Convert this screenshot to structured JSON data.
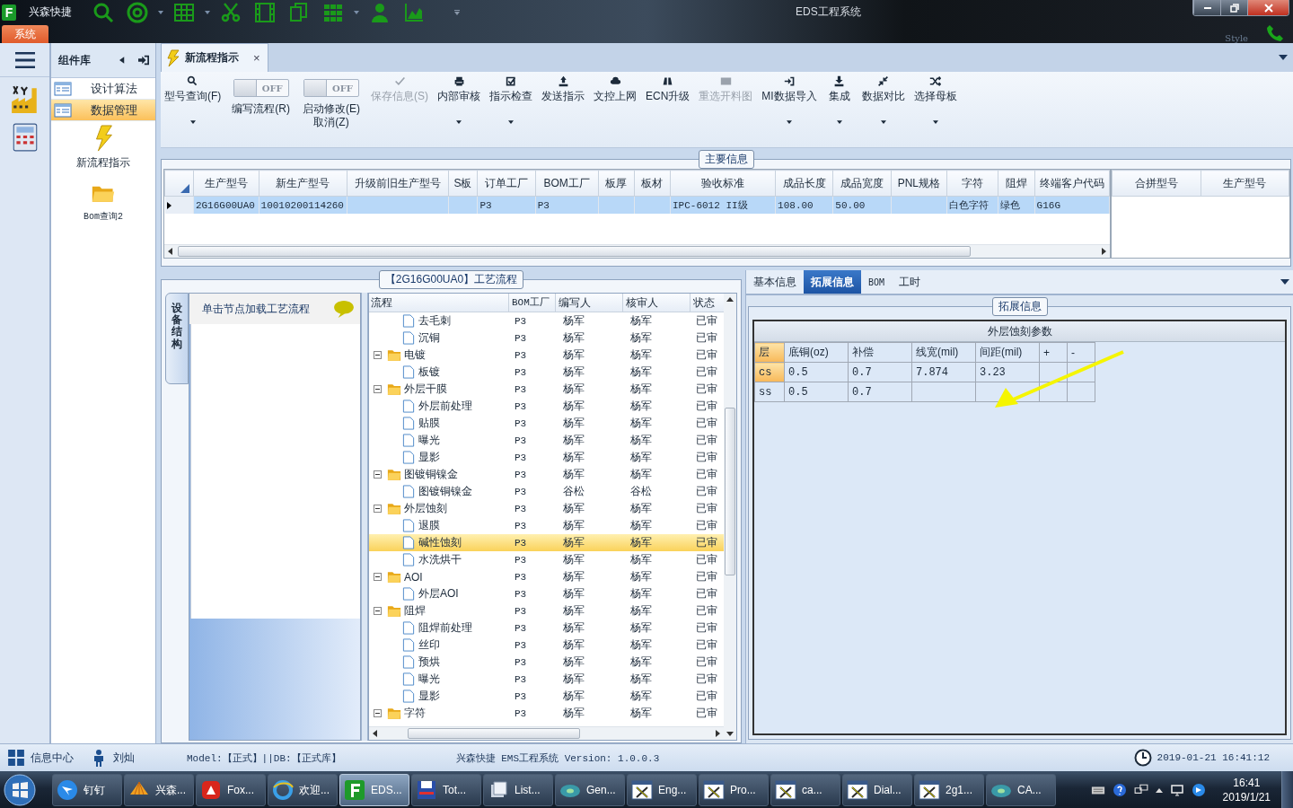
{
  "window": {
    "logo_text": "F",
    "app_name": "兴森快捷",
    "title": "EDS工程系统",
    "menu_tab": "系统",
    "style_label": "Style"
  },
  "nav": {
    "title": "组件库",
    "items": [
      {
        "label": "设计算法",
        "selected": false
      },
      {
        "label": "数据管理",
        "selected": true
      }
    ],
    "tools": [
      {
        "label": "新流程指示"
      },
      {
        "label": "Bom查询2"
      }
    ]
  },
  "doc_tab": {
    "label": "新流程指示",
    "close": "×",
    "selected": true
  },
  "ribbon": [
    {
      "kind": "button",
      "lines": [
        "型号查询(F)"
      ],
      "menu": true,
      "disabled": false
    },
    {
      "kind": "toggle",
      "state_text": "OFF",
      "on": false,
      "lines": [
        "编写流程(R)"
      ]
    },
    {
      "kind": "toggle",
      "state_text": "OFF",
      "on": false,
      "lines": [
        "启动修改(E)",
        "取消(Z)"
      ]
    },
    {
      "kind": "button",
      "lines": [
        "保存信息(S)"
      ],
      "menu": false,
      "disabled": true
    },
    {
      "kind": "button",
      "lines": [
        "内部审核"
      ],
      "menu": true,
      "disabled": false
    },
    {
      "kind": "button",
      "lines": [
        "指示检查"
      ],
      "menu": true,
      "disabled": false
    },
    {
      "kind": "button",
      "lines": [
        "发送指示"
      ],
      "menu": false,
      "disabled": false
    },
    {
      "kind": "button",
      "lines": [
        "文控上网"
      ],
      "menu": false,
      "disabled": false
    },
    {
      "kind": "button",
      "lines": [
        "ECN升级"
      ],
      "menu": false,
      "disabled": false
    },
    {
      "kind": "button",
      "lines": [
        "重选开料图"
      ],
      "menu": false,
      "disabled": true
    },
    {
      "kind": "button",
      "lines": [
        "MI数据导入"
      ],
      "menu": true,
      "disabled": false
    },
    {
      "kind": "button",
      "lines": [
        "集成"
      ],
      "menu": true,
      "disabled": false
    },
    {
      "kind": "button",
      "lines": [
        "数据对比"
      ],
      "menu": true,
      "disabled": false
    },
    {
      "kind": "button",
      "lines": [
        "选择母板"
      ],
      "menu": true,
      "disabled": false
    }
  ],
  "main_info": {
    "title": "主要信息",
    "columns": [
      "生产型号",
      "新生产型号",
      "升级前旧生产型号",
      "S板",
      "订单工厂",
      "BOM工厂",
      "板厚",
      "板材",
      "验收标准",
      "成品长度",
      "成品宽度",
      "PNL规格",
      "字符",
      "阻焊",
      "终端客户代码"
    ],
    "rows": [
      {
        "selected": true,
        "cells": [
          "2G16G00UA0",
          "10010200114260",
          "",
          "",
          "P3",
          "P3",
          "",
          "",
          "IPC-6012 II级",
          "108.00",
          "50.00",
          "",
          "白色字符",
          "绿色",
          "G16G"
        ]
      }
    ],
    "side_columns": [
      "合拼型号",
      "生产型号"
    ]
  },
  "flow": {
    "title": "【2G16G00UA0】工艺流程",
    "side_tab": "设备结构",
    "hint": "单击节点加载工艺流程",
    "columns": [
      "流程",
      "BOM工厂",
      "编写人",
      "核审人",
      "状态"
    ],
    "nodes": [
      {
        "children": [
          {
            "label": "去毛刺",
            "bom": "P3",
            "writer": "杨军",
            "reviewer": "杨军",
            "status": "已审",
            "selected": false
          },
          {
            "label": "沉铜",
            "bom": "P3",
            "writer": "杨军",
            "reviewer": "杨军",
            "status": "已审",
            "selected": false
          }
        ]
      },
      {
        "label": "电镀",
        "bom": "P3",
        "writer": "杨军",
        "reviewer": "杨军",
        "status": "已审",
        "selected": false,
        "expanded": true,
        "children": [
          {
            "label": "板镀",
            "bom": "P3",
            "writer": "杨军",
            "reviewer": "杨军",
            "status": "已审",
            "selected": false
          }
        ]
      },
      {
        "label": "外层干膜",
        "bom": "P3",
        "writer": "杨军",
        "reviewer": "杨军",
        "status": "已审",
        "selected": false,
        "expanded": true,
        "children": [
          {
            "label": "外层前处理",
            "bom": "P3",
            "writer": "杨军",
            "reviewer": "杨军",
            "status": "已审",
            "selected": false
          },
          {
            "label": "贴膜",
            "bom": "P3",
            "writer": "杨军",
            "reviewer": "杨军",
            "status": "已审",
            "selected": false
          },
          {
            "label": "曝光",
            "bom": "P3",
            "writer": "杨军",
            "reviewer": "杨军",
            "status": "已审",
            "selected": false
          },
          {
            "label": "显影",
            "bom": "P3",
            "writer": "杨军",
            "reviewer": "杨军",
            "status": "已审",
            "selected": false
          }
        ]
      },
      {
        "label": "图镀铜镍金",
        "bom": "P3",
        "writer": "杨军",
        "reviewer": "杨军",
        "status": "已审",
        "selected": false,
        "expanded": true,
        "children": [
          {
            "label": "图镀铜镍金",
            "bom": "P3",
            "writer": "谷松",
            "reviewer": "谷松",
            "status": "已审",
            "selected": false
          }
        ]
      },
      {
        "label": "外层蚀刻",
        "bom": "P3",
        "writer": "杨军",
        "reviewer": "杨军",
        "status": "已审",
        "selected": false,
        "expanded": true,
        "children": [
          {
            "label": "退膜",
            "bom": "P3",
            "writer": "杨军",
            "reviewer": "杨军",
            "status": "已审",
            "selected": false
          },
          {
            "label": "碱性蚀刻",
            "bom": "P3",
            "writer": "杨军",
            "reviewer": "杨军",
            "status": "已审",
            "selected": true
          },
          {
            "label": "水洗烘干",
            "bom": "P3",
            "writer": "杨军",
            "reviewer": "杨军",
            "status": "已审",
            "selected": false
          }
        ]
      },
      {
        "label": "AOI",
        "bom": "P3",
        "writer": "杨军",
        "reviewer": "杨军",
        "status": "已审",
        "selected": false,
        "expanded": true,
        "children": [
          {
            "label": "外层AOI",
            "bom": "P3",
            "writer": "杨军",
            "reviewer": "杨军",
            "status": "已审",
            "selected": false
          }
        ]
      },
      {
        "label": "阻焊",
        "bom": "P3",
        "writer": "杨军",
        "reviewer": "杨军",
        "status": "已审",
        "selected": false,
        "expanded": true,
        "children": [
          {
            "label": "阻焊前处理",
            "bom": "P3",
            "writer": "杨军",
            "reviewer": "杨军",
            "status": "已审",
            "selected": false
          },
          {
            "label": "丝印",
            "bom": "P3",
            "writer": "杨军",
            "reviewer": "杨军",
            "status": "已审",
            "selected": false
          },
          {
            "label": "预烘",
            "bom": "P3",
            "writer": "杨军",
            "reviewer": "杨军",
            "status": "已审",
            "selected": false
          },
          {
            "label": "曝光",
            "bom": "P3",
            "writer": "杨军",
            "reviewer": "杨军",
            "status": "已审",
            "selected": false
          },
          {
            "label": "显影",
            "bom": "P3",
            "writer": "杨军",
            "reviewer": "杨军",
            "status": "已审",
            "selected": false
          }
        ]
      },
      {
        "label": "字符",
        "bom": "P3",
        "writer": "杨军",
        "reviewer": "杨军",
        "status": "已审",
        "selected": false,
        "expanded": true
      }
    ]
  },
  "detail": {
    "tabs": [
      {
        "label": "基本信息",
        "selected": false
      },
      {
        "label": "拓展信息",
        "selected": true
      },
      {
        "label": "BOM",
        "selected": false
      },
      {
        "label": "工时",
        "selected": false
      }
    ],
    "group_title": "拓展信息",
    "table": {
      "title": "外层蚀刻参数",
      "columns": [
        "层",
        "底铜(oz)",
        "补偿",
        "线宽(mil)",
        "间距(mil)",
        "+",
        "-"
      ],
      "rows": [
        {
          "selected": true,
          "cells": [
            "cs",
            "0.5",
            "0.7",
            "7.874",
            "3.23"
          ]
        },
        {
          "selected": false,
          "cells": [
            "ss",
            "0.5",
            "0.7"
          ]
        }
      ]
    }
  },
  "status_bar": {
    "info_center": "信息中心",
    "user": "刘灿",
    "db": "Model:【正式】||DB:【正式库】",
    "product": "兴森快捷 EMS工程系统 Version: 1.0.0.3",
    "datetime": "2019-01-21 16:41:12"
  },
  "taskbar": {
    "tasks": [
      {
        "label": "钉钉",
        "selected": false
      },
      {
        "label": "兴森...",
        "selected": false
      },
      {
        "label": "Fox...",
        "selected": false
      },
      {
        "label": "欢迎...",
        "selected": false
      },
      {
        "label": "EDS...",
        "selected": true
      },
      {
        "label": "Tot...",
        "selected": false
      },
      {
        "label": "List...",
        "selected": false
      },
      {
        "label": "Gen...",
        "selected": false
      },
      {
        "label": "Eng...",
        "selected": false
      },
      {
        "label": "Pro...",
        "selected": false
      },
      {
        "label": "ca...",
        "selected": false
      },
      {
        "label": "Dial...",
        "selected": false
      },
      {
        "label": "2g1...",
        "selected": false
      },
      {
        "label": "CA...",
        "selected": false
      }
    ],
    "time": "16:41",
    "date": "2019/1/21"
  }
}
